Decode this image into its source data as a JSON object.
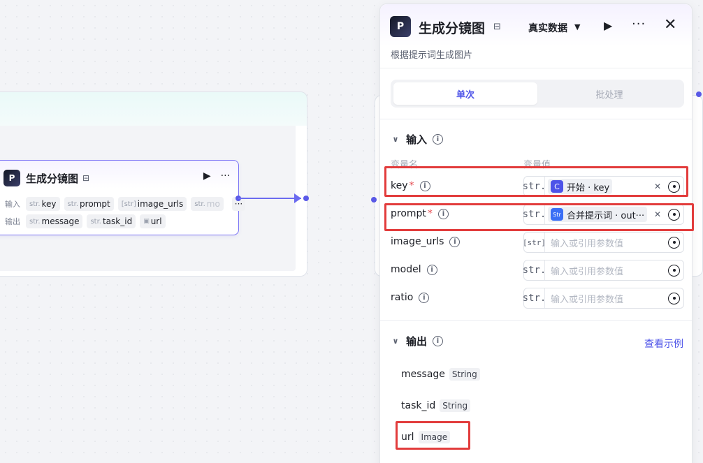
{
  "canvas_node": {
    "logo_text": "P",
    "title": "生成分镜图",
    "input_label": "输入",
    "output_label": "输出",
    "inputs": [
      {
        "type": "str.",
        "name": "key"
      },
      {
        "type": "str.",
        "name": "prompt"
      },
      {
        "type": "[str]",
        "name": "image_urls"
      },
      {
        "type": "str.",
        "name": "mo"
      }
    ],
    "more_label": "···",
    "outputs": [
      {
        "type": "str.",
        "name": "message"
      },
      {
        "type": "str.",
        "name": "task_id"
      },
      {
        "type": "img",
        "name": "url"
      }
    ]
  },
  "panel": {
    "logo_text": "P",
    "title": "生成分镜图",
    "mode_label": "真实数据",
    "description": "根据提示词生成图片",
    "tabs": [
      {
        "label": "单次",
        "active": true
      },
      {
        "label": "批处理",
        "active": false
      }
    ],
    "input_section": {
      "title": "输入",
      "col_name": "变量名",
      "col_value": "变量值",
      "params": [
        {
          "name": "key",
          "required": true,
          "type": "str.",
          "ref_icon": "C",
          "ref_text": "开始 · key",
          "placeholder": ""
        },
        {
          "name": "prompt",
          "required": true,
          "type": "str.",
          "ref_icon": "Str",
          "ref_text": "合并提示词 · out···",
          "placeholder": ""
        },
        {
          "name": "image_urls",
          "required": false,
          "type": "[str]",
          "ref_icon": "",
          "ref_text": "",
          "placeholder": "输入或引用参数值"
        },
        {
          "name": "model",
          "required": false,
          "type": "str.",
          "ref_icon": "",
          "ref_text": "",
          "placeholder": "输入或引用参数值"
        },
        {
          "name": "ratio",
          "required": false,
          "type": "str.",
          "ref_icon": "",
          "ref_text": "",
          "placeholder": "输入或引用参数值"
        }
      ]
    },
    "output_section": {
      "title": "输出",
      "link": "查看示例",
      "items": [
        {
          "name": "message",
          "type": "String"
        },
        {
          "name": "task_id",
          "type": "String"
        },
        {
          "name": "url",
          "type": "Image"
        }
      ]
    }
  },
  "colors": {
    "accent": "#4d53e8",
    "highlight": "#e23c3c",
    "edge": "#6b6bf0"
  }
}
